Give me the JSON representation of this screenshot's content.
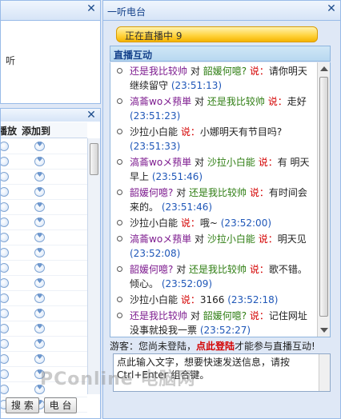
{
  "left_top": {
    "text": "听"
  },
  "playlist": {
    "headers": [
      "播放",
      "添加到"
    ],
    "row_count": 18,
    "buttons": [
      "搜 索",
      "电 台"
    ]
  },
  "radio": {
    "title": "一听电台",
    "status": "正在直播中   9",
    "section_title": "直播互动",
    "said_word": "说：",
    "to_word": "对",
    "messages": [
      {
        "from": "还是我比较帅",
        "from_color": "purple",
        "to": "韶媛何噫?",
        "to_color": "green",
        "text": "请你明天继续留守",
        "time": "(23:51:13)"
      },
      {
        "from": "滈菕woメ蓣単",
        "from_color": "purple",
        "to": "还是我比较帅",
        "to_color": "green",
        "text": "走好",
        "time": "(23:51:23)"
      },
      {
        "from": "沙拉小白能",
        "from_color": "black",
        "to": "",
        "to_color": "",
        "text": "小娜明天有节目吗?",
        "time": "(23:51:33)"
      },
      {
        "from": "滈菕woメ蓣単",
        "from_color": "purple",
        "to": "沙拉小白能",
        "to_color": "green",
        "text": "有 明天早上",
        "time": "(23:51:46)"
      },
      {
        "from": "韶媛何噫?",
        "from_color": "purple",
        "to": "还是我比较帅",
        "to_color": "green",
        "text": "有时间会来的。",
        "time": "(23:51:46)"
      },
      {
        "from": "沙拉小白能",
        "from_color": "black",
        "to": "",
        "to_color": "",
        "text": "哦~",
        "time": "(23:52:00)"
      },
      {
        "from": "滈菕woメ蓣単",
        "from_color": "purple",
        "to": "沙拉小白能",
        "to_color": "green",
        "text": "明天见",
        "time": "(23:52:08)"
      },
      {
        "from": "韶媛何噫?",
        "from_color": "purple",
        "to": "还是我比较帅",
        "to_color": "green",
        "text": "歌不错。倾心。",
        "time": "(23:52:09)"
      },
      {
        "from": "沙拉小白能",
        "from_color": "black",
        "to": "",
        "to_color": "",
        "text": "3166",
        "time": "(23:52:18)"
      },
      {
        "from": "还是我比较帅",
        "from_color": "purple",
        "to": "韶媛何噫?",
        "to_color": "green",
        "text": "记住网址 没事就投我一票",
        "time": "(23:52:27)"
      }
    ],
    "guest_prefix": "游客：您尚未登陆，",
    "guest_login": "点此登陆",
    "guest_suffix": "才能参与直播互动!",
    "input_text": "点此输入文字，想要快速发送信息，请按 Ctrl+Enter 组合键。"
  },
  "watermark": "PConline 电脑网",
  "colors": {
    "purple": "#7d1b8f",
    "green": "#2e7d12",
    "red": "#d40000",
    "time": "#1f57b8",
    "status_bg": "#ffd23a"
  },
  "icons": {
    "close": "close-icon",
    "play": "play-icon",
    "add": "heart-icon"
  }
}
